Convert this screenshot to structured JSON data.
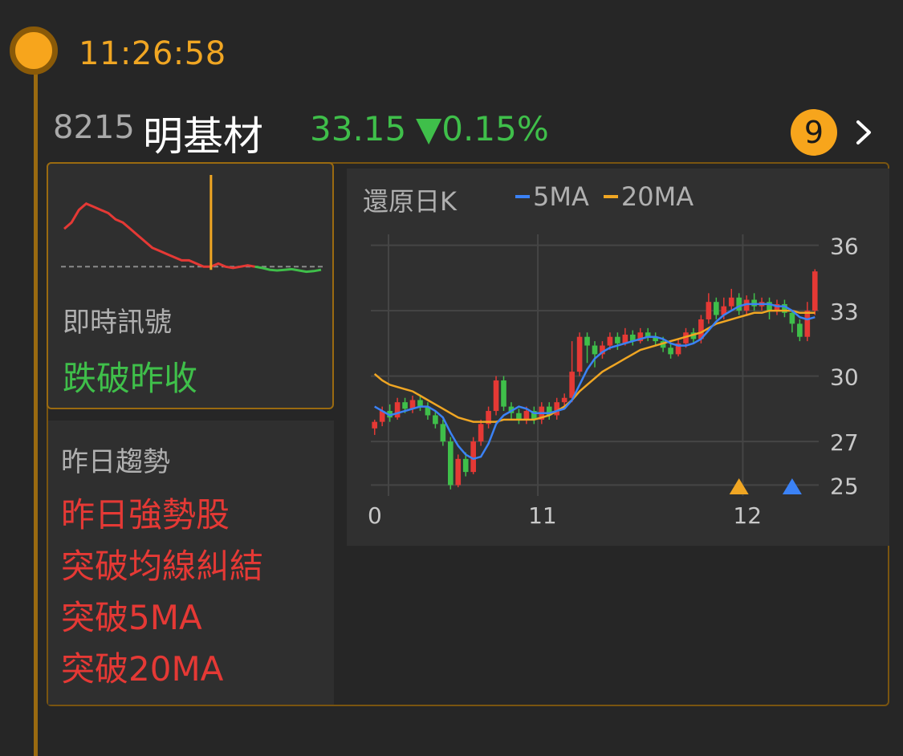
{
  "time": "11:26:58",
  "stock": {
    "code": "8215",
    "name": "明基材",
    "price": "33.15",
    "change": "▼0.15%",
    "badge_count": "9"
  },
  "signal": {
    "label": "即時訊號",
    "value": "跌破昨收"
  },
  "trend": {
    "label": "昨日趨勢",
    "items": [
      "昨日強勢股",
      "突破均線糾結",
      "突破5MA",
      "突破20MA"
    ]
  },
  "colors": {
    "accent": "#f7a51c",
    "up": "#e53935",
    "down": "#3fbf4a",
    "ma5": "#3b82f6",
    "ma20": "#f0a623",
    "buy_marker": "#f0a623",
    "signal_marker": "#3b82f6"
  },
  "chart_data": [
    {
      "type": "line",
      "title": "",
      "series": [
        {
          "color": "#e53935",
          "values": [
            33.8,
            33.9,
            34.1,
            34.2,
            34.15,
            34.1,
            34.05,
            33.95,
            33.9,
            33.8,
            33.7,
            33.6,
            33.5,
            33.45,
            33.4,
            33.35,
            33.3,
            33.3,
            33.25,
            33.2,
            33.2,
            33.25,
            33.2,
            33.18,
            33.2,
            33.22,
            33.2
          ]
        },
        {
          "color": "#3fbf4a",
          "values": [
            33.2,
            33.18,
            33.15,
            33.14,
            33.15,
            33.16,
            33.14,
            33.12,
            33.13,
            33.15
          ]
        }
      ],
      "reference_line": 33.2,
      "marker_index": 20,
      "ylim": [
        33.0,
        34.4
      ]
    },
    {
      "type": "candlestick",
      "title": "還原日K",
      "legend": [
        "5MA",
        "20MA"
      ],
      "x_tick_labels": [
        "0",
        "11",
        "12"
      ],
      "x_tick_positions": [
        0,
        22,
        49
      ],
      "y_tick_labels": [
        "36",
        "33",
        "30",
        "27",
        "25"
      ],
      "y_tick_values": [
        36,
        33,
        30,
        27,
        25
      ],
      "ylim": [
        24.5,
        36.5
      ],
      "grid": true,
      "candles": [
        [
          27.6,
          27.9,
          27.3,
          28.0
        ],
        [
          27.9,
          28.4,
          27.7,
          28.6
        ],
        [
          28.4,
          28.1,
          27.9,
          28.7
        ],
        [
          28.1,
          28.8,
          28.0,
          29.0
        ],
        [
          28.8,
          28.5,
          28.3,
          29.0
        ],
        [
          28.5,
          28.9,
          28.3,
          29.1
        ],
        [
          28.9,
          28.6,
          28.4,
          29.1
        ],
        [
          28.6,
          28.2,
          28.0,
          28.8
        ],
        [
          28.2,
          27.8,
          27.6,
          28.4
        ],
        [
          27.8,
          27.0,
          26.8,
          28.0
        ],
        [
          27.0,
          25.0,
          24.8,
          27.2
        ],
        [
          25.0,
          26.2,
          24.9,
          26.4
        ],
        [
          26.2,
          25.6,
          25.4,
          26.5
        ],
        [
          25.6,
          27.0,
          25.5,
          27.2
        ],
        [
          27.0,
          27.8,
          26.8,
          28.0
        ],
        [
          27.8,
          28.4,
          27.6,
          28.6
        ],
        [
          28.4,
          29.8,
          28.2,
          30.0
        ],
        [
          29.8,
          28.6,
          28.4,
          30.0
        ],
        [
          28.6,
          28.3,
          28.0,
          28.8
        ],
        [
          28.3,
          28.0,
          27.8,
          28.5
        ],
        [
          28.0,
          28.4,
          27.8,
          28.6
        ],
        [
          28.4,
          28.0,
          27.8,
          28.6
        ],
        [
          28.0,
          28.6,
          27.8,
          28.8
        ],
        [
          28.6,
          28.2,
          28.0,
          28.8
        ],
        [
          28.2,
          28.8,
          28.0,
          29.0
        ],
        [
          28.8,
          29.0,
          28.6,
          29.2
        ],
        [
          29.0,
          30.2,
          28.8,
          31.6
        ],
        [
          30.2,
          31.8,
          30.0,
          32.0
        ],
        [
          31.8,
          31.4,
          30.6,
          32.0
        ],
        [
          31.4,
          31.0,
          30.4,
          31.6
        ],
        [
          31.0,
          31.4,
          30.8,
          31.6
        ],
        [
          31.4,
          31.8,
          31.2,
          32.0
        ],
        [
          31.8,
          31.5,
          31.2,
          32.0
        ],
        [
          31.5,
          31.9,
          31.4,
          32.2
        ],
        [
          31.9,
          31.6,
          31.4,
          32.1
        ],
        [
          31.6,
          32.0,
          31.5,
          32.2
        ],
        [
          32.0,
          31.8,
          31.6,
          32.2
        ],
        [
          31.8,
          31.6,
          31.4,
          32.0
        ],
        [
          31.6,
          31.3,
          31.1,
          31.8
        ],
        [
          31.3,
          31.0,
          30.8,
          31.5
        ],
        [
          31.0,
          31.5,
          30.9,
          31.7
        ],
        [
          31.5,
          32.0,
          31.3,
          32.2
        ],
        [
          32.0,
          31.7,
          31.5,
          32.2
        ],
        [
          31.7,
          32.6,
          31.5,
          32.8
        ],
        [
          32.6,
          33.4,
          32.4,
          33.8
        ],
        [
          33.4,
          32.8,
          32.6,
          33.6
        ],
        [
          32.8,
          33.2,
          32.6,
          33.6
        ],
        [
          33.2,
          33.6,
          33.0,
          34.0
        ],
        [
          33.6,
          33.0,
          32.8,
          33.8
        ],
        [
          33.0,
          33.5,
          32.8,
          33.7
        ],
        [
          33.5,
          33.2,
          33.0,
          33.8
        ],
        [
          33.2,
          33.4,
          33.0,
          33.6
        ],
        [
          33.4,
          33.0,
          32.6,
          33.6
        ],
        [
          33.0,
          33.3,
          32.8,
          33.5
        ],
        [
          33.3,
          32.9,
          32.7,
          33.5
        ],
        [
          32.9,
          32.4,
          32.0,
          33.0
        ],
        [
          32.4,
          31.8,
          31.6,
          32.6
        ],
        [
          31.8,
          33.0,
          31.6,
          33.4
        ],
        [
          33.0,
          34.8,
          32.8,
          34.9
        ]
      ],
      "ma5": [
        28.6,
        28.4,
        28.2,
        28.3,
        28.4,
        28.5,
        28.6,
        28.6,
        28.4,
        28.1,
        27.4,
        26.8,
        26.4,
        26.2,
        26.3,
        26.9,
        27.8,
        28.2,
        28.4,
        28.6,
        28.5,
        28.3,
        28.3,
        28.3,
        28.4,
        28.5,
        28.9,
        29.6,
        30.3,
        30.8,
        31.1,
        31.3,
        31.4,
        31.5,
        31.6,
        31.7,
        31.8,
        31.8,
        31.7,
        31.5,
        31.4,
        31.4,
        31.5,
        31.7,
        32.1,
        32.5,
        32.8,
        33.0,
        33.2,
        33.3,
        33.3,
        33.3,
        33.3,
        33.2,
        33.2,
        33.0,
        32.7,
        32.6,
        32.7
      ],
      "ma20": [
        30.1,
        29.8,
        29.6,
        29.5,
        29.4,
        29.3,
        29.1,
        28.9,
        28.7,
        28.5,
        28.3,
        28.1,
        28.0,
        27.9,
        27.9,
        27.9,
        27.9,
        28.0,
        28.0,
        28.0,
        28.0,
        28.0,
        28.1,
        28.2,
        28.4,
        28.6,
        28.9,
        29.3,
        29.6,
        29.9,
        30.2,
        30.4,
        30.6,
        30.8,
        31.0,
        31.2,
        31.3,
        31.4,
        31.5,
        31.6,
        31.7,
        31.8,
        31.9,
        32.0,
        32.2,
        32.4,
        32.5,
        32.6,
        32.7,
        32.8,
        32.9,
        32.9,
        33.0,
        33.0,
        33.0,
        33.0,
        32.9,
        32.9,
        32.9
      ],
      "markers": [
        {
          "index": 48,
          "shape": "triangle-up",
          "color": "#f0a623"
        },
        {
          "index": 55,
          "shape": "triangle-up",
          "color": "#3b82f6"
        }
      ]
    }
  ]
}
